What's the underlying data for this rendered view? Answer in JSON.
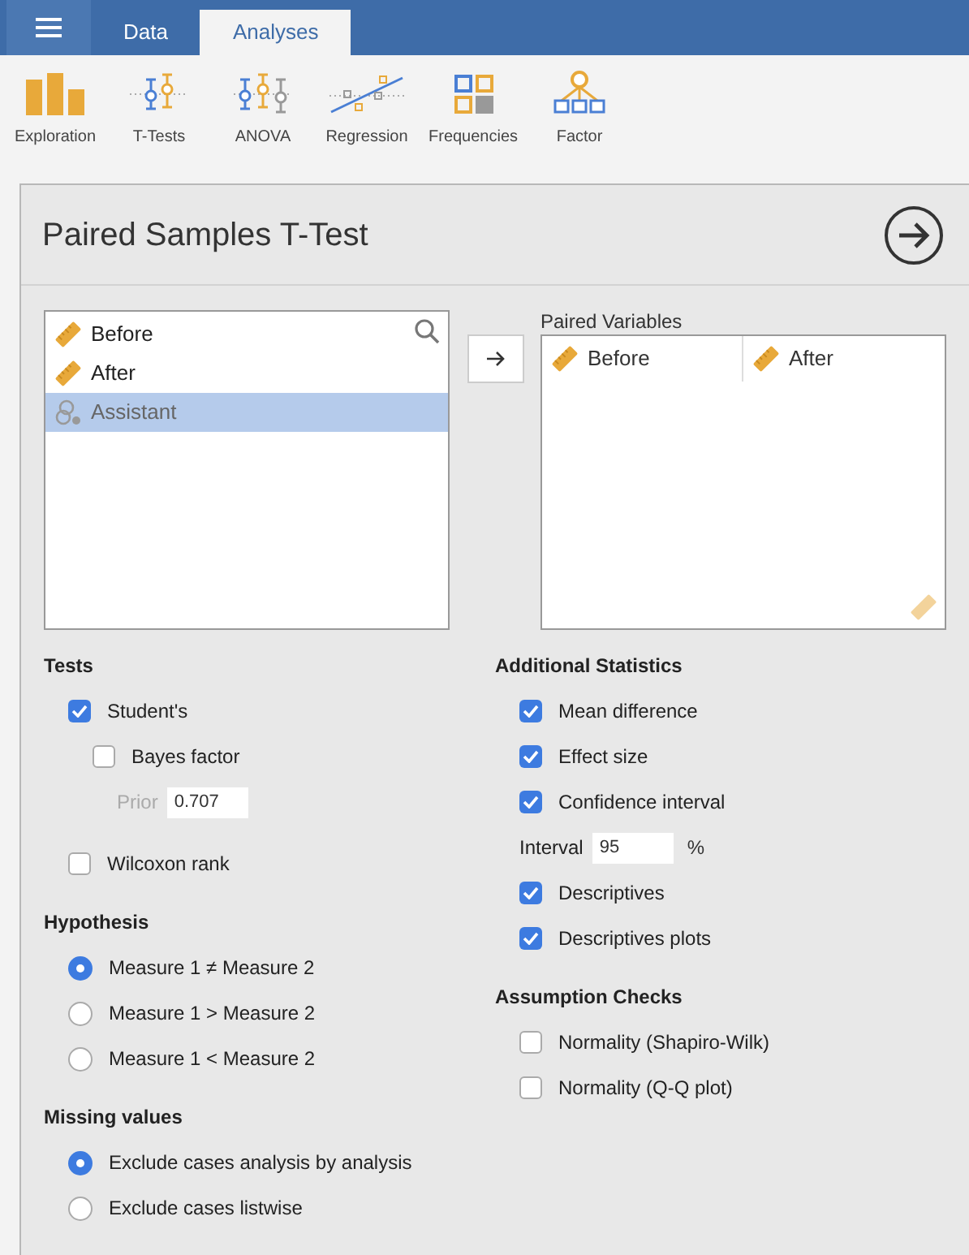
{
  "tabs": [
    {
      "label": "Data",
      "selected": false
    },
    {
      "label": "Analyses",
      "selected": true
    }
  ],
  "toolbar": [
    {
      "kind": "exploration",
      "label": "Exploration"
    },
    {
      "kind": "ttests",
      "label": "T-Tests"
    },
    {
      "kind": "anova",
      "label": "ANOVA"
    },
    {
      "kind": "regression",
      "label": "Regression"
    },
    {
      "kind": "frequencies",
      "label": "Frequencies"
    },
    {
      "kind": "factor",
      "label": "Factor"
    }
  ],
  "analysis": {
    "title": "Paired Samples T-Test"
  },
  "variables": [
    {
      "name": "Before",
      "kind": "continuous",
      "selected": false
    },
    {
      "name": "After",
      "kind": "continuous",
      "selected": false
    },
    {
      "name": "Assistant",
      "kind": "nominal",
      "selected": true
    }
  ],
  "paired": {
    "label": "Paired Variables",
    "pairs": [
      [
        "Before",
        "After"
      ]
    ]
  },
  "columns": [
    [
      {
        "heading": "Tests",
        "items": [
          {
            "kind": "checkbox",
            "label": "Student's",
            "checked": true,
            "children": [
              {
                "kind": "checkbox",
                "label": "Bayes factor",
                "checked": false,
                "children": [
                  {
                    "kind": "number",
                    "label": "Prior",
                    "value": "0.707",
                    "disabled": true
                  }
                ]
              }
            ]
          },
          {
            "kind": "checkbox",
            "label": "Wilcoxon rank",
            "checked": false
          }
        ]
      },
      {
        "heading": "Hypothesis",
        "items": [
          {
            "kind": "radio",
            "label": "Measure 1 ≠ Measure 2",
            "selected": true
          },
          {
            "kind": "radio",
            "label": "Measure 1 > Measure 2",
            "selected": false
          },
          {
            "kind": "radio",
            "label": "Measure 1 < Measure 2",
            "selected": false
          }
        ]
      },
      {
        "heading": "Missing values",
        "items": [
          {
            "kind": "radio",
            "label": "Exclude cases analysis by analysis",
            "selected": true
          },
          {
            "kind": "radio",
            "label": "Exclude cases listwise",
            "selected": false
          }
        ]
      }
    ],
    [
      {
        "heading": "Additional Statistics",
        "items": [
          {
            "kind": "checkbox",
            "label": "Mean difference",
            "checked": true
          },
          {
            "kind": "checkbox",
            "label": "Effect size",
            "checked": true
          },
          {
            "kind": "checkbox",
            "label": "Confidence interval",
            "checked": true
          },
          {
            "kind": "number",
            "label": "Interval",
            "value": "95",
            "suffix": "%",
            "disabled": false
          },
          {
            "kind": "checkbox",
            "label": "Descriptives",
            "checked": true
          },
          {
            "kind": "checkbox",
            "label": "Descriptives plots",
            "checked": true
          }
        ]
      },
      {
        "heading": "Assumption Checks",
        "items": [
          {
            "kind": "checkbox",
            "label": "Normality (Shapiro-Wilk)",
            "checked": false
          },
          {
            "kind": "checkbox",
            "label": "Normality (Q-Q plot)",
            "checked": false
          }
        ]
      }
    ]
  ]
}
